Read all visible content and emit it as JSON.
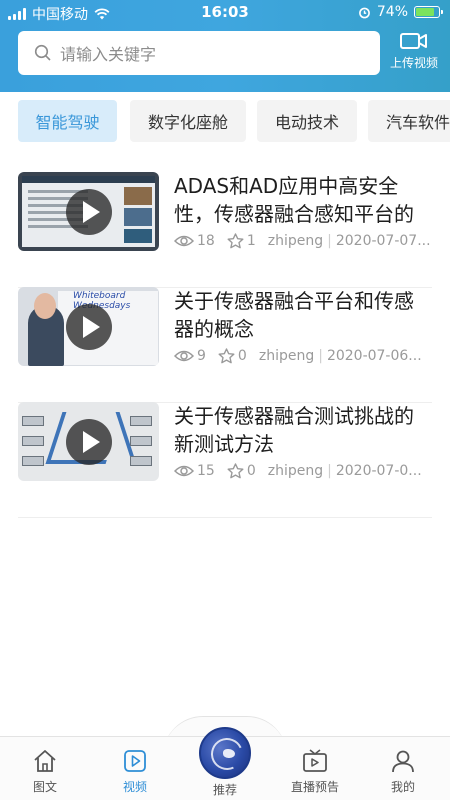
{
  "status_bar": {
    "carrier": "中国移动",
    "time": "16:03",
    "battery_text": "74%",
    "battery_level": 0.74
  },
  "header": {
    "search_placeholder": "请输入关键字",
    "upload_label": "上传视频"
  },
  "category_tabs": [
    {
      "label": "智能驾驶",
      "active": true
    },
    {
      "label": "数字化座舱",
      "active": false
    },
    {
      "label": "电动技术",
      "active": false
    },
    {
      "label": "汽车软件",
      "active": false
    }
  ],
  "videos": [
    {
      "title": "ADAS和AD应用中高安全性，传感器融合感知平台的",
      "views": "18",
      "likes": "1",
      "author": "zhipeng",
      "date": "2020-07-07..."
    },
    {
      "title": "关于传感器融合平台和传感器的概念",
      "views": "9",
      "likes": "0",
      "author": "zhipeng",
      "date": "2020-07-06..."
    },
    {
      "title": "关于传感器融合测试挑战的新测试方法",
      "views": "15",
      "likes": "0",
      "author": "zhipeng",
      "date": "2020-07-0..."
    }
  ],
  "thumbnails": {
    "video_2_board_heading": "Whiteboard Wednesdays"
  },
  "bottom_nav": [
    {
      "label": "图文",
      "icon": "home-icon",
      "active": false
    },
    {
      "label": "视频",
      "icon": "video-play-icon",
      "active": true
    },
    {
      "label": "推荐",
      "icon": "app-logo-icon",
      "active": false
    },
    {
      "label": "直播预告",
      "icon": "tv-icon",
      "active": false
    },
    {
      "label": "我的",
      "icon": "user-icon",
      "active": false
    }
  ],
  "colors": {
    "header_blue": "#3aa0dc",
    "accent_blue": "#2e8ed6",
    "active_tab_bg": "#d8ecfa"
  }
}
